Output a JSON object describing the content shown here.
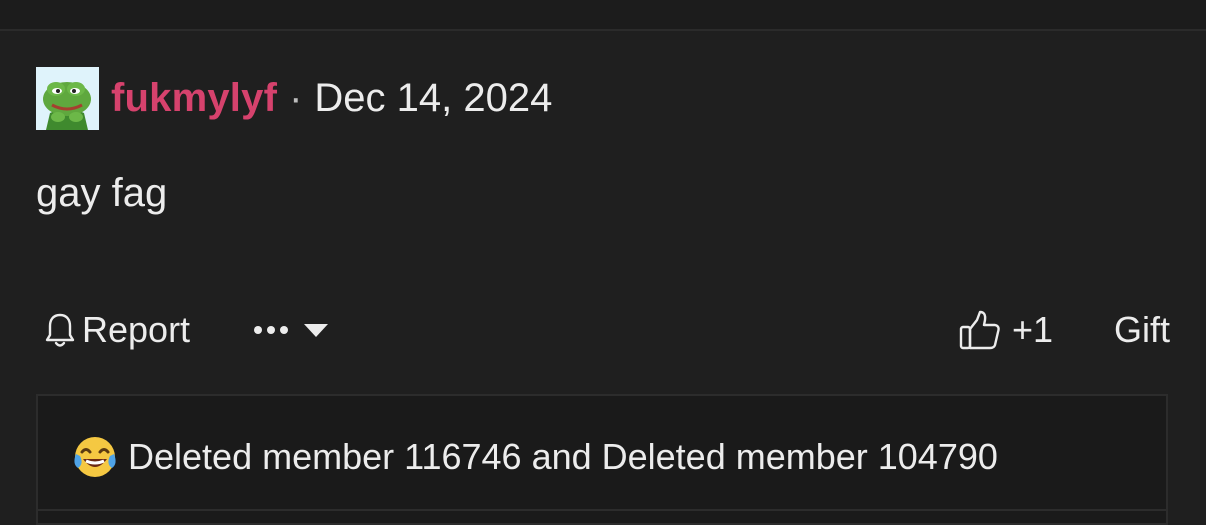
{
  "post": {
    "username": "fukmylyf",
    "separator": "·",
    "date": "Dec 14, 2024",
    "message": "gay fag",
    "avatar_icon": "frog-avatar"
  },
  "actions": {
    "report_label": "Report",
    "report_icon": "bell-icon",
    "more_icon": "ellipsis-icon",
    "dropdown_icon": "caret-down-icon",
    "like_icon": "thumbs-up-icon",
    "like_count": "+1",
    "gift_label": "Gift"
  },
  "reactions": {
    "emoji_icon": "tears-of-joy-emoji",
    "text": "Deleted member 116746 and Deleted member 104790"
  },
  "colors": {
    "background": "#1f1f1f",
    "username": "#d6426d",
    "text": "#ececec"
  }
}
